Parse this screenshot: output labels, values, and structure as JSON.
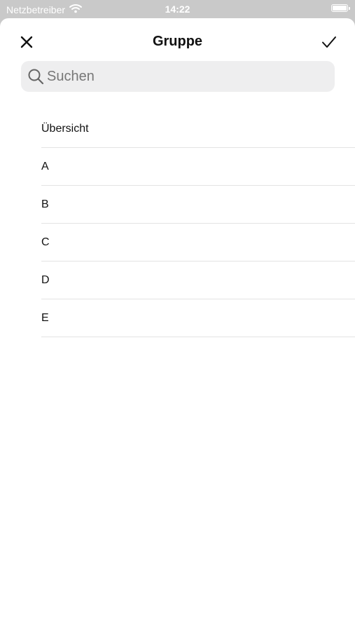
{
  "status_bar": {
    "carrier": "Netzbetreiber",
    "time": "14:22",
    "icons": [
      "wifi-icon",
      "battery-icon"
    ]
  },
  "nav": {
    "title": "Gruppe",
    "close_icon": "close-icon",
    "confirm_icon": "checkmark-icon"
  },
  "search": {
    "placeholder": "Suchen",
    "value": "",
    "icon": "search-icon"
  },
  "list": {
    "items": [
      {
        "label": "Übersicht"
      },
      {
        "label": "A"
      },
      {
        "label": "B"
      },
      {
        "label": "C"
      },
      {
        "label": "D"
      },
      {
        "label": "E"
      }
    ]
  },
  "colors": {
    "sheet_background": "#ffffff",
    "backdrop": "#c9c9c9",
    "search_background": "#eeeeef",
    "separator": "#e3e3e3",
    "text": "#111111"
  }
}
